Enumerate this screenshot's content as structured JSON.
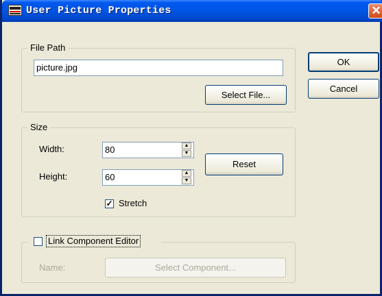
{
  "window": {
    "title": "User Picture Properties",
    "close_glyph": "✕"
  },
  "file_path": {
    "legend": "File Path",
    "value": "picture.jpg",
    "select_file_label": "Select File..."
  },
  "size": {
    "legend": "Size",
    "width_label": "Width:",
    "width_value": "80",
    "height_label": "Height:",
    "height_value": "60",
    "reset_label": "Reset",
    "stretch_label": "Stretch",
    "stretch_checked": true
  },
  "link": {
    "legend": "Link Component Editor",
    "checked": false,
    "name_label": "Name:",
    "select_component_label": "Select Component..."
  },
  "buttons": {
    "ok_label": "OK",
    "cancel_label": "Cancel"
  },
  "icons": {
    "spin_up": "▲",
    "spin_down": "▼",
    "check": "✓"
  }
}
